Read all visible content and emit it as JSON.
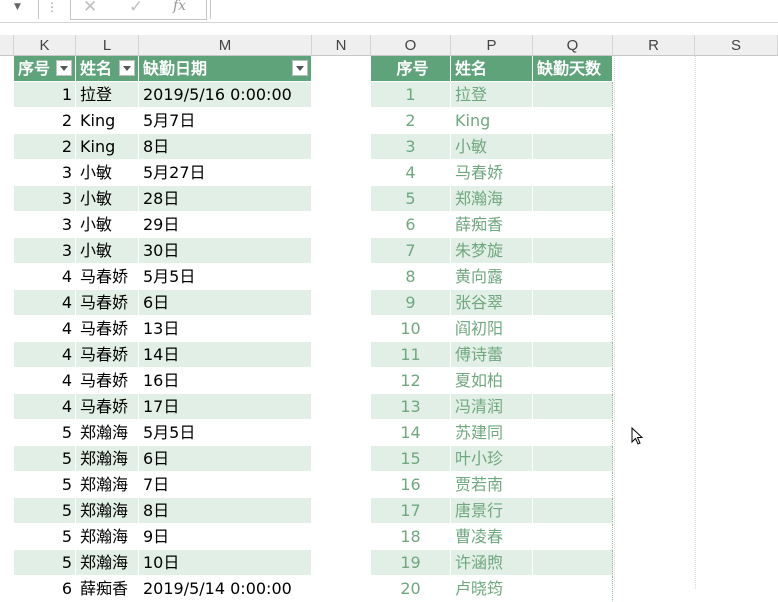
{
  "formula_bar": {
    "fx_label": "fx",
    "cancel_glyph": "✕",
    "enter_glyph": "✓"
  },
  "columns": [
    "K",
    "L",
    "M",
    "N",
    "O",
    "P",
    "Q",
    "R",
    "S"
  ],
  "table1": {
    "headers": [
      "序号",
      "姓名",
      "缺勤日期"
    ],
    "rows": [
      [
        "1",
        "拉登",
        "2019/5/16 0:00:00"
      ],
      [
        "2",
        "King",
        "5月7日"
      ],
      [
        "2",
        "King",
        "8日"
      ],
      [
        "3",
        "小敏",
        "5月27日"
      ],
      [
        "3",
        "小敏",
        "28日"
      ],
      [
        "3",
        "小敏",
        "29日"
      ],
      [
        "3",
        "小敏",
        "30日"
      ],
      [
        "4",
        "马春娇",
        "5月5日"
      ],
      [
        "4",
        "马春娇",
        "6日"
      ],
      [
        "4",
        "马春娇",
        "13日"
      ],
      [
        "4",
        "马春娇",
        "14日"
      ],
      [
        "4",
        "马春娇",
        "16日"
      ],
      [
        "4",
        "马春娇",
        "17日"
      ],
      [
        "5",
        "郑瀚海",
        "5月5日"
      ],
      [
        "5",
        "郑瀚海",
        "6日"
      ],
      [
        "5",
        "郑瀚海",
        "7日"
      ],
      [
        "5",
        "郑瀚海",
        "8日"
      ],
      [
        "5",
        "郑瀚海",
        "9日"
      ],
      [
        "5",
        "郑瀚海",
        "10日"
      ],
      [
        "6",
        "薛痴香",
        "2019/5/14 0:00:00"
      ]
    ]
  },
  "table2": {
    "headers": [
      "序号",
      "姓名",
      "缺勤天数"
    ],
    "rows": [
      [
        "1",
        "拉登",
        ""
      ],
      [
        "2",
        "King",
        ""
      ],
      [
        "3",
        "小敏",
        ""
      ],
      [
        "4",
        "马春娇",
        ""
      ],
      [
        "5",
        "郑瀚海",
        ""
      ],
      [
        "6",
        "薛痴香",
        ""
      ],
      [
        "7",
        "朱梦旋",
        ""
      ],
      [
        "8",
        "黄向露",
        ""
      ],
      [
        "9",
        "张谷翠",
        ""
      ],
      [
        "10",
        "阎初阳",
        ""
      ],
      [
        "11",
        "傅诗蕾",
        ""
      ],
      [
        "12",
        "夏如柏",
        ""
      ],
      [
        "13",
        "冯清润",
        ""
      ],
      [
        "14",
        "苏建同",
        ""
      ],
      [
        "15",
        "叶小珍",
        ""
      ],
      [
        "16",
        "贾若南",
        ""
      ],
      [
        "17",
        "唐景行",
        ""
      ],
      [
        "18",
        "曹凌春",
        ""
      ],
      [
        "19",
        "许涵煦",
        ""
      ],
      [
        "20",
        "卢晓筠",
        ""
      ]
    ]
  }
}
